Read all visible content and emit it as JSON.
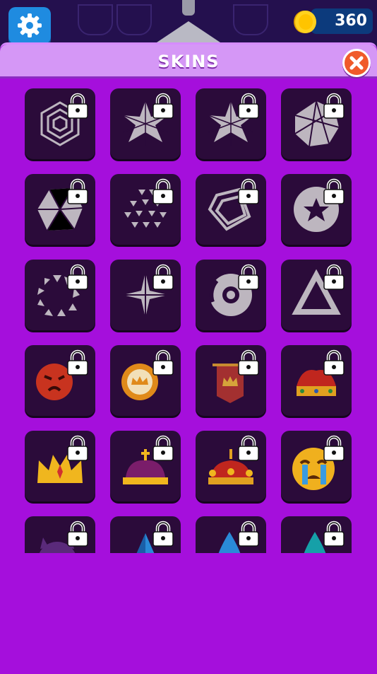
{
  "header": {
    "title": "SKINS"
  },
  "wallet": {
    "coins": "360"
  },
  "skins": [
    {
      "name": "hexagon-rings",
      "locked": true
    },
    {
      "name": "star-burst",
      "locked": true
    },
    {
      "name": "star-burst-alt",
      "locked": true
    },
    {
      "name": "triangle-sphere",
      "locked": true
    },
    {
      "name": "geodesic-gem",
      "locked": true
    },
    {
      "name": "triangle-dots",
      "locked": true
    },
    {
      "name": "folded-square",
      "locked": true
    },
    {
      "name": "star-circle",
      "locked": true
    },
    {
      "name": "triangle-ring",
      "locked": true
    },
    {
      "name": "compass-star",
      "locked": true
    },
    {
      "name": "brake-disc",
      "locked": true
    },
    {
      "name": "penrose-triangle",
      "locked": true
    },
    {
      "name": "angry-face",
      "locked": true
    },
    {
      "name": "crown-badge",
      "locked": true
    },
    {
      "name": "crown-banner",
      "locked": true
    },
    {
      "name": "royal-crown",
      "locked": true
    },
    {
      "name": "gold-crown",
      "locked": true
    },
    {
      "name": "purple-crown",
      "locked": true
    },
    {
      "name": "red-crown",
      "locked": true
    },
    {
      "name": "crying-face",
      "locked": true
    },
    {
      "name": "devil-face",
      "locked": true
    },
    {
      "name": "blue-crystal",
      "locked": true
    },
    {
      "name": "blue-drop",
      "locked": true
    },
    {
      "name": "teal-drop",
      "locked": true
    }
  ],
  "colors": {
    "panel": "#a50fdc",
    "header": "#d597f6",
    "tile": "#2b0b3a",
    "settings": "#1f8be0",
    "close": "#f05a2a"
  }
}
